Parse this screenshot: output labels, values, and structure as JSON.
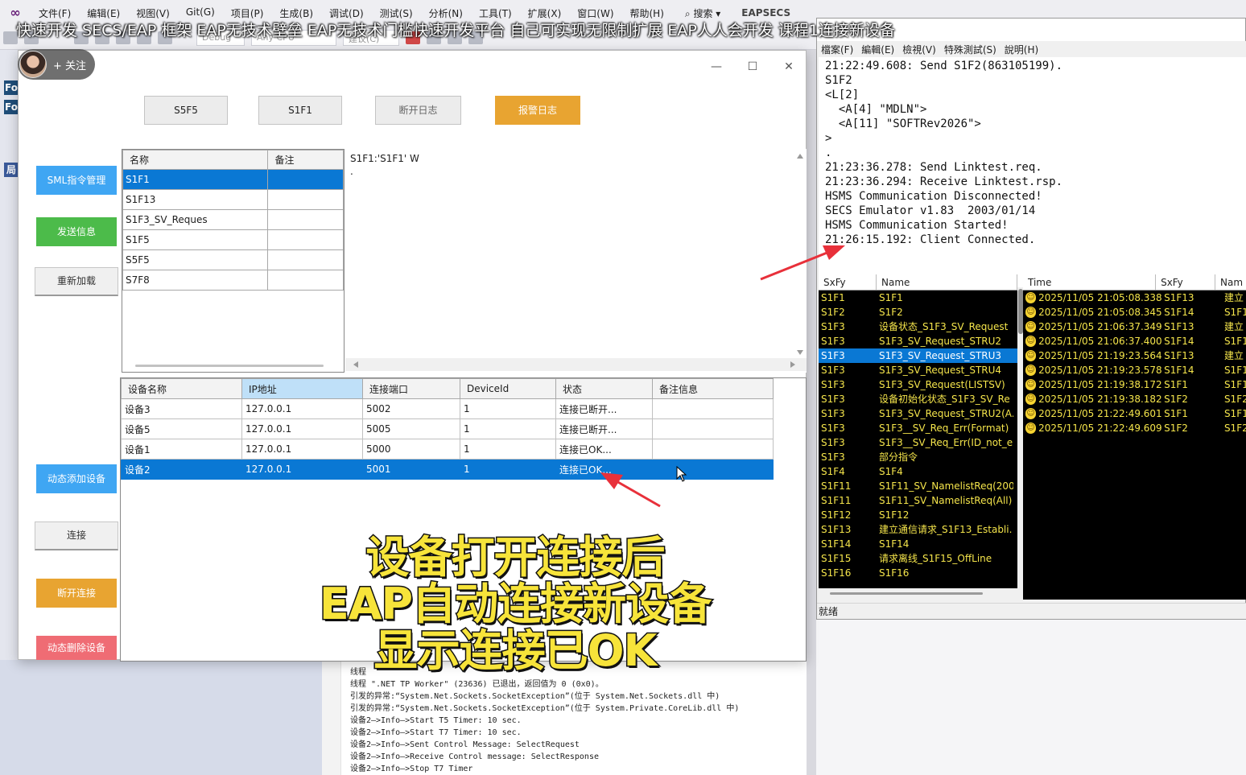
{
  "vs": {
    "menus": [
      "文件(F)",
      "编辑(E)",
      "视图(V)",
      "Git(G)",
      "项目(P)",
      "生成(B)",
      "调试(D)",
      "测试(S)",
      "分析(N)",
      "工具(T)",
      "扩展(X)",
      "窗口(W)",
      "帮助(H)"
    ],
    "search": "搜索",
    "project": "EAPSECS",
    "config": "Debug",
    "platform": "Any CPU",
    "run_label": "建议(C)",
    "left_tab_1": "Fo",
    "left_tab_2": "Fo",
    "left_tab_3": "局",
    "output_lines": [
      "线程 ",
      "线程 \".NET TP Worker\" (23636) 已退出，返回值为 0 (0x0)。",
      "引发的异常:“System.Net.Sockets.SocketException”(位于 System.Net.Sockets.dll 中)",
      "引发的异常:“System.Net.Sockets.SocketException”(位于 System.Private.CoreLib.dll 中)",
      "设备2—>Info—>Start T5 Timer: 10 sec.",
      "设备2—>Info—>Start T7 Timer: 10 sec.",
      "设备2—>Info—>Sent Control Message: SelectRequest",
      "设备2—>Info—>Receive Control message: SelectResponse",
      "设备2—>Info—>Stop T7 Timer"
    ]
  },
  "overlay": {
    "title": "快速开发 SECS/EAP 框架 EAP无技术壁垒 EAP无技术门槛快速开发平台 自己可实现无限制扩展 EAP人人会开发 课程1连接新设备",
    "follow": "+ 关注",
    "subtitle": [
      "设备打开连接后",
      "EAP自动连接新设备",
      "显示连接已OK"
    ]
  },
  "eap": {
    "top_buttons": [
      "S5F5",
      "S1F1",
      "断开日志",
      "报警日志"
    ],
    "side_buttons": [
      "SML指令管理",
      "发送信息",
      "重新加载",
      "动态添加设备",
      "连接",
      "断开连接",
      "动态删除设备"
    ],
    "cmd_columns": [
      "名称",
      "备注"
    ],
    "cmd_rows": [
      {
        "name": "S1F1",
        "note": ""
      },
      {
        "name": "S1F13",
        "note": ""
      },
      {
        "name": "S1F3_SV_Reques",
        "note": ""
      },
      {
        "name": "S1F5",
        "note": ""
      },
      {
        "name": "S5F5",
        "note": ""
      },
      {
        "name": "S7F8",
        "note": ""
      }
    ],
    "cmd_selected_index": 0,
    "sml_text": [
      "S1F1:'S1F1' W",
      "."
    ],
    "device_columns": [
      "设备名称",
      "IP地址",
      "连接端口",
      "DeviceId",
      "状态",
      "备注信息"
    ],
    "device_rows": [
      {
        "name": "设备3",
        "ip": "127.0.0.1",
        "port": "5002",
        "id": "1",
        "status": "连接已断开...",
        "note": ""
      },
      {
        "name": "设备5",
        "ip": "127.0.0.1",
        "port": "5005",
        "id": "1",
        "status": "连接已断开...",
        "note": ""
      },
      {
        "name": "设备1",
        "ip": "127.0.0.1",
        "port": "5000",
        "id": "1",
        "status": "连接已OK...",
        "note": ""
      },
      {
        "name": "设备2",
        "ip": "127.0.0.1",
        "port": "5001",
        "id": "1",
        "status": "连接已OK...",
        "note": ""
      }
    ],
    "device_selected_index": 3
  },
  "emulator": {
    "menus": [
      "檔案(F)",
      "編輯(E)",
      "檢視(V)",
      "特殊測試(S)",
      "說明(H)"
    ],
    "log_lines": [
      "21:22:49.608: Send S1F2(863105199).",
      "S1F2",
      "<L[2]",
      "  <A[4] \"MDLN\">",
      "  <A[11] \"SOFTRev2026\">",
      ">",
      ".",
      "21:23:36.278: Send Linktest.req.",
      "21:23:36.294: Receive Linktest.rsp.",
      "HSMS Communication Disconnected!",
      "SECS Emulator v1.83  2003/01/14",
      "HSMS Communication Started!",
      "21:26:15.192: Client Connected."
    ],
    "list_columns": [
      "SxFy",
      "Name"
    ],
    "list_rows": [
      {
        "sxfy": "S1F1",
        "name": "S1F1"
      },
      {
        "sxfy": "S1F2",
        "name": "S1F2"
      },
      {
        "sxfy": "S1F3",
        "name": "设备状态_S1F3_SV_Request"
      },
      {
        "sxfy": "S1F3",
        "name": "S1F3_SV_Request_STRU2"
      },
      {
        "sxfy": "S1F3",
        "name": "S1F3_SV_Request_STRU3"
      },
      {
        "sxfy": "S1F3",
        "name": "S1F3_SV_Request_STRU4"
      },
      {
        "sxfy": "S1F3",
        "name": "S1F3_SV_Request(LISTSV)"
      },
      {
        "sxfy": "S1F3",
        "name": "设备初始化状态_S1F3_SV_Re"
      },
      {
        "sxfy": "S1F3",
        "name": "S1F3_SV_Request_STRU2(A."
      },
      {
        "sxfy": "S1F3",
        "name": "S1F3__SV_Req_Err(Format)"
      },
      {
        "sxfy": "S1F3",
        "name": "S1F3__SV_Req_Err(ID_not_e."
      },
      {
        "sxfy": "S1F3",
        "name": "部分指令"
      },
      {
        "sxfy": "S1F4",
        "name": "S1F4"
      },
      {
        "sxfy": "S1F11",
        "name": "S1F11_SV_NamelistReq(200"
      },
      {
        "sxfy": "S1F11",
        "name": "S1F11_SV_NamelistReq(All)"
      },
      {
        "sxfy": "S1F12",
        "name": "S1F12"
      },
      {
        "sxfy": "S1F13",
        "name": "建立通信请求_S1F13_Establi."
      },
      {
        "sxfy": "S1F14",
        "name": "S1F14"
      },
      {
        "sxfy": "S1F15",
        "name": "请求离线_S1F15_OffLine"
      },
      {
        "sxfy": "S1F16",
        "name": "S1F16"
      }
    ],
    "list_selected_index": 4,
    "log2_columns": [
      "Time",
      "SxFy",
      "Nam"
    ],
    "log2_rows": [
      {
        "time": "2025/11/05 21:05:08.338",
        "sxfy": "S1F13",
        "name": "建立"
      },
      {
        "time": "2025/11/05 21:05:08.345",
        "sxfy": "S1F14",
        "name": "S1F1"
      },
      {
        "time": "2025/11/05 21:06:37.349",
        "sxfy": "S1F13",
        "name": "建立"
      },
      {
        "time": "2025/11/05 21:06:37.400",
        "sxfy": "S1F14",
        "name": "S1F1"
      },
      {
        "time": "2025/11/05 21:19:23.564",
        "sxfy": "S1F13",
        "name": "建立"
      },
      {
        "time": "2025/11/05 21:19:23.578",
        "sxfy": "S1F14",
        "name": "S1F1"
      },
      {
        "time": "2025/11/05 21:19:38.172",
        "sxfy": "S1F1",
        "name": "S1F1"
      },
      {
        "time": "2025/11/05 21:19:38.182",
        "sxfy": "S1F2",
        "name": "S1F2"
      },
      {
        "time": "2025/11/05 21:22:49.601",
        "sxfy": "S1F1",
        "name": "S1F1"
      },
      {
        "time": "2025/11/05 21:22:49.609",
        "sxfy": "S1F2",
        "name": "S1F2"
      }
    ],
    "status": "就绪"
  },
  "colors": {
    "accent_blue": "#3fa6f3",
    "accent_green": "#4cbb4a",
    "accent_orange": "#e8a431",
    "accent_red": "#ef6c74",
    "selection": "#0a78d4",
    "emulator_text": "#f5e54b",
    "subtitle_yellow": "#f7e43a",
    "arrow_red": "#e8303a"
  }
}
